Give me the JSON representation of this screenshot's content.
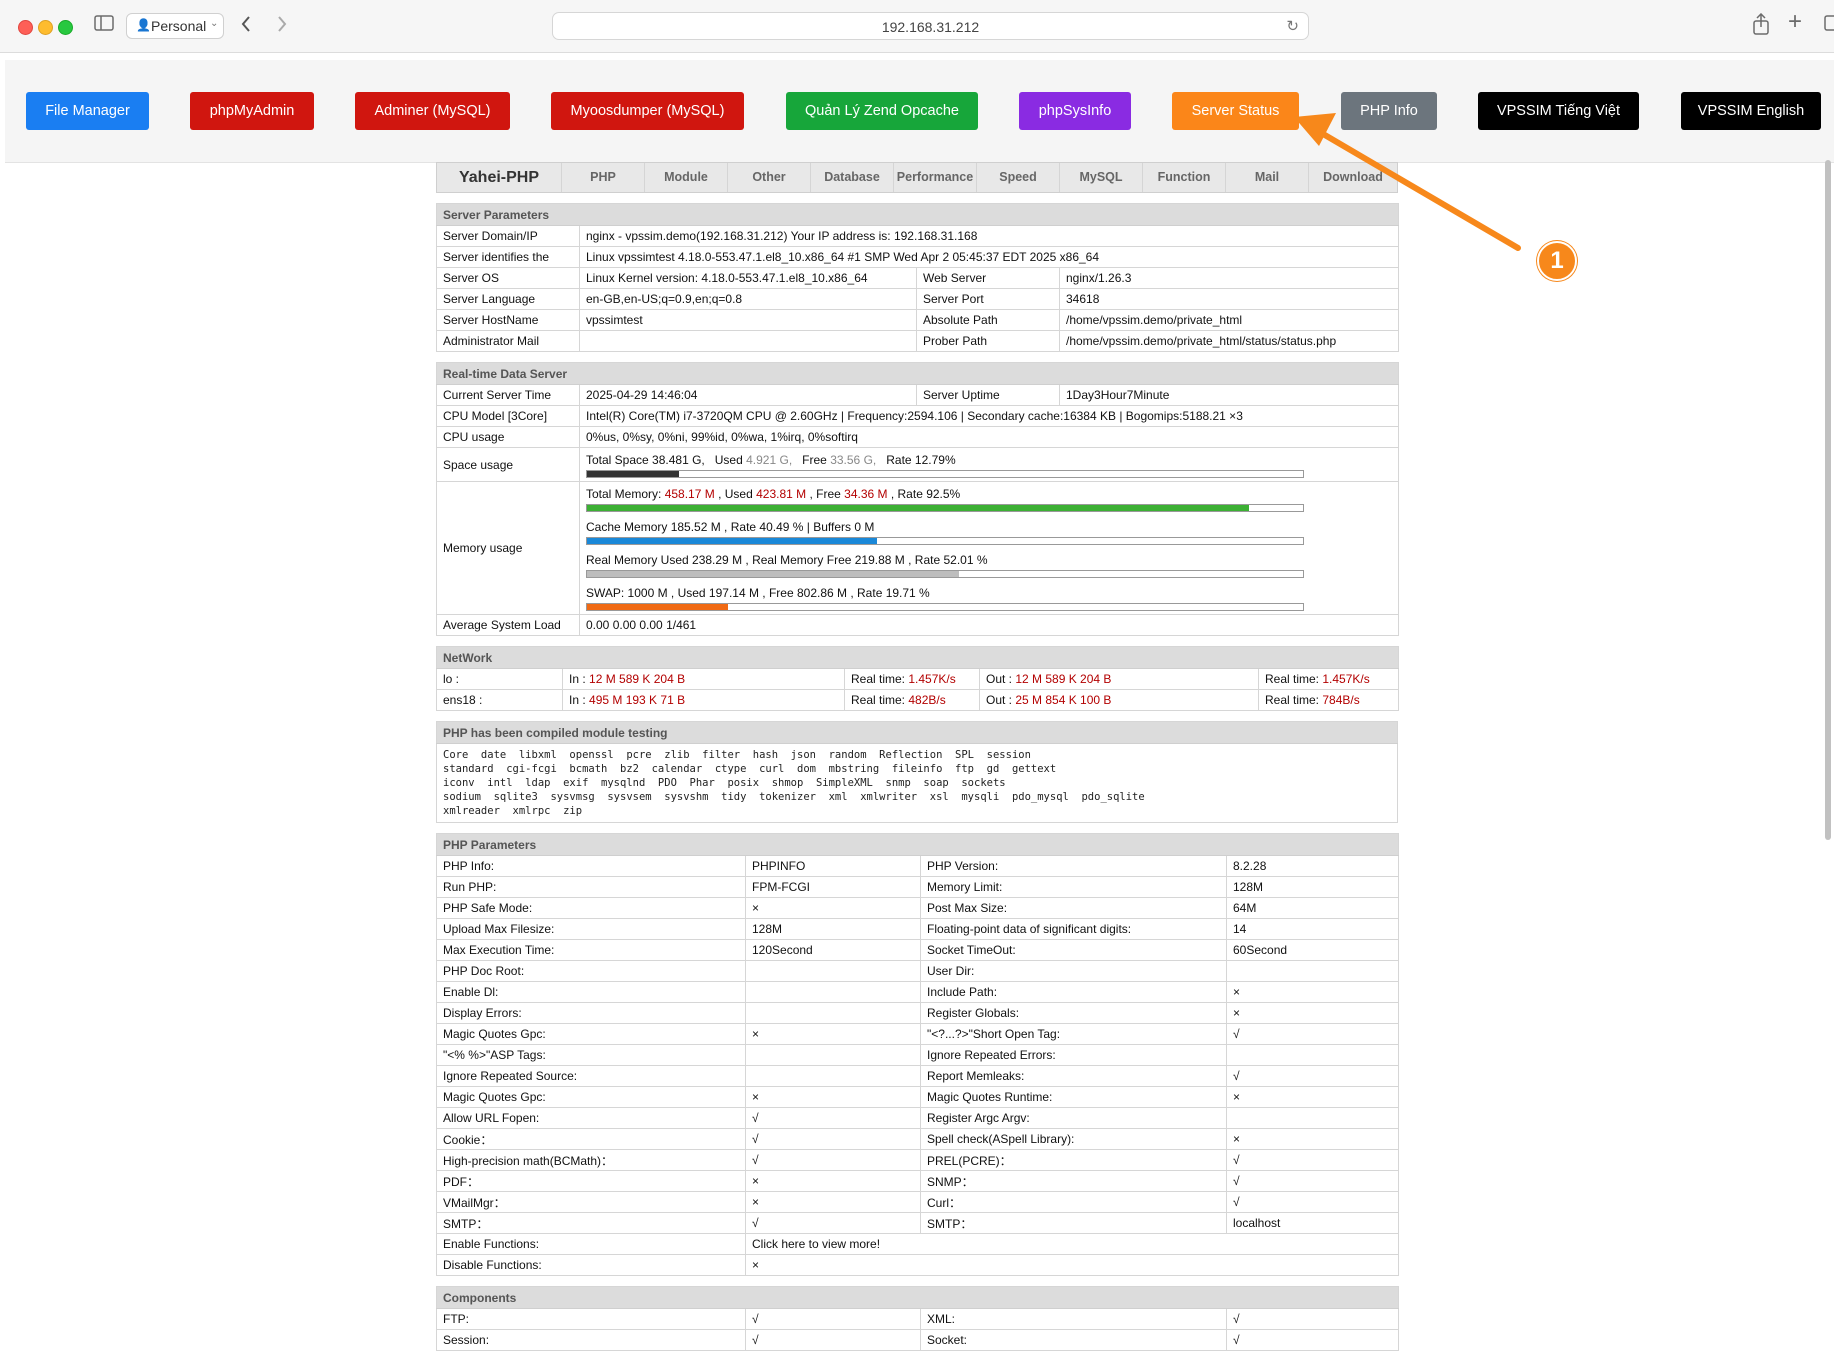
{
  "browser": {
    "profile": "Personal",
    "url": "192.168.31.212"
  },
  "nav": [
    {
      "label": "File Manager",
      "color": "#1a7ef2"
    },
    {
      "label": "phpMyAdmin",
      "color": "#d0160f"
    },
    {
      "label": "Adminer (MySQL)",
      "color": "#d0160f"
    },
    {
      "label": "Myoosdumper (MySQL)",
      "color": "#d0160f"
    },
    {
      "label": "Quản Lý Zend Opcache",
      "color": "#17a63a"
    },
    {
      "label": "phpSysInfo",
      "color": "#8a2be2"
    },
    {
      "label": "Server Status",
      "color": "#fb8619"
    },
    {
      "label": "PHP Info",
      "color": "#6c757d"
    },
    {
      "label": "VPSSIM Tiếng Việt",
      "color": "#000000"
    },
    {
      "label": "VPSSIM English",
      "color": "#000000"
    }
  ],
  "tabs": [
    "Yahei-PHP",
    "PHP",
    "Module",
    "Other",
    "Database",
    "Performance",
    "Speed",
    "MySQL",
    "Function",
    "Mail",
    "Download"
  ],
  "server_params": {
    "title": "Server Parameters",
    "domain_label": "Server Domain/IP",
    "domain_value": "nginx - vpssim.demo(192.168.31.212)  Your IP address is: 192.168.31.168",
    "ident_label": "Server identifies the",
    "ident_value": "Linux vpssimtest 4.18.0-553.47.1.el8_10.x86_64 #1 SMP Wed Apr 2 05:45:37 EDT 2025 x86_64",
    "os_label": "Server OS",
    "os_value": "Linux  Kernel version: 4.18.0-553.47.1.el8_10.x86_64",
    "web_label": "Web Server",
    "web_value": "nginx/1.26.3",
    "lang_label": "Server Language",
    "lang_value": "en-GB,en-US;q=0.9,en;q=0.8",
    "port_label": "Server Port",
    "port_value": "34618",
    "host_label": "Server HostName",
    "host_value": "vpssimtest",
    "abs_label": "Absolute Path",
    "abs_value": "/home/vpssim.demo/private_html",
    "mail_label": "Administrator Mail",
    "mail_value": "",
    "prober_label": "Prober Path",
    "prober_value": "/home/vpssim.demo/private_html/status/status.php"
  },
  "realtime": {
    "title": "Real-time Data Server",
    "time_label": "Current Server Time",
    "time_value": "2025-04-29 14:46:04",
    "uptime_label": "Server Uptime",
    "uptime_value": "1Day3Hour7Minute",
    "cpu_label": "CPU Model [3Core]",
    "cpu_value": "Intel(R) Core(TM) i7-3720QM CPU @ 2.60GHz | Frequency:2594.106 | Secondary cache:16384 KB | Bogomips:5188.21 ×3",
    "cpu_usage_label": "CPU usage",
    "cpu_usage_value": "0%us, 0%sy, 0%ni, 99%id, 0%wa, 1%irq, 0%softirq",
    "space_label": "Space usage",
    "space": {
      "total": "Total Space 38.481 G,",
      "used_lbl": "Used",
      "used": "4.921 G,",
      "free_lbl": "Free",
      "free": "33.56 G,",
      "rate": "Rate 12.79%",
      "fraction": 0.1279
    },
    "mem_label": "Memory usage",
    "mem_total": {
      "t1": "Total Memory: ",
      "v1": "458.17 M",
      "t2": " , Used ",
      "v2": "423.81 M",
      "t3": " , Free ",
      "v3": "34.36 M",
      "t4": " , Rate 92.5%",
      "fraction": 0.925
    },
    "mem_cache": {
      "text": "Cache Memory 185.52 M , Rate 40.49 % | Buffers 0 M",
      "fraction": 0.4049
    },
    "mem_real": {
      "text": "Real Memory Used 238.29 M , Real Memory Free 219.88 M , Rate 52.01 %",
      "fraction": 0.5201
    },
    "mem_swap": {
      "text": "SWAP: 1000 M , Used 197.14 M , Free 802.86 M , Rate 19.71 %",
      "fraction": 0.1971
    },
    "load_label": "Average System Load",
    "load_value": "0.00 0.00 0.00 1/461"
  },
  "network": {
    "title": "NetWork",
    "rows": [
      {
        "iface": "lo :",
        "in_lbl": "In : ",
        "in": "12 M 589 K 204 B",
        "rt_lbl": "Real time: ",
        "rt_in": "1.457K/s",
        "out_lbl": "Out : ",
        "out": "12 M 589 K 204 B",
        "rt_out": "1.457K/s"
      },
      {
        "iface": "ens18 :",
        "in_lbl": "In : ",
        "in": "495 M 193 K 71 B",
        "rt_lbl": "Real time: ",
        "rt_in": "482B/s",
        "out_lbl": "Out : ",
        "out": "25 M 854 K 100 B",
        "rt_out": "784B/s"
      }
    ]
  },
  "modules": {
    "title": "PHP has been compiled module testing",
    "text": "Core  date  libxml  openssl  pcre  zlib  filter  hash  json  random  Reflection  SPL  session\nstandard  cgi-fcgi  bcmath  bz2  calendar  ctype  curl  dom  mbstring  fileinfo  ftp  gd  gettext\niconv  intl  ldap  exif  mysqlnd  PDO  Phar  posix  shmop  SimpleXML  snmp  soap  sockets\nsodium  sqlite3  sysvmsg  sysvsem  sysvshm  tidy  tokenizer  xml  xmlwriter  xsl  mysqli  pdo_mysql  pdo_sqlite\nxmlreader  xmlrpc  zip"
  },
  "php_params": {
    "title": "PHP Parameters",
    "rows": [
      [
        "PHP Info:",
        "PHPINFO",
        "PHP Version:",
        "8.2.28"
      ],
      [
        "Run PHP:",
        "FPM-FCGI",
        "Memory Limit:",
        "128M"
      ],
      [
        "PHP Safe Mode:",
        "×",
        "Post Max Size:",
        "64M"
      ],
      [
        "Upload Max Filesize:",
        "128M",
        "Floating-point data of significant digits:",
        "14"
      ],
      [
        "Max Execution Time:",
        "120Second",
        "Socket TimeOut:",
        "60Second"
      ],
      [
        "PHP Doc Root:",
        "",
        "User Dir:",
        ""
      ],
      [
        "Enable Dl:",
        "",
        "Include Path:",
        "×"
      ],
      [
        "Display Errors:",
        "",
        "Register Globals:",
        "×"
      ],
      [
        "Magic Quotes Gpc:",
        "×",
        "\"<?...?>\"Short Open Tag:",
        "√"
      ],
      [
        "\"<% %>\"ASP Tags:",
        "",
        "Ignore Repeated Errors:",
        ""
      ],
      [
        "Ignore Repeated Source:",
        "",
        "Report Memleaks:",
        "√"
      ],
      [
        "Magic Quotes Gpc:",
        "×",
        "Magic Quotes Runtime:",
        "×"
      ],
      [
        "Allow URL Fopen:",
        "√",
        "Register Argc Argv:",
        ""
      ],
      [
        "Cookie：",
        "√",
        "Spell check(ASpell Library):",
        "×"
      ],
      [
        "High-precision math(BCMath)：",
        "√",
        "PREL(PCRE)：",
        "√"
      ],
      [
        "PDF：",
        "×",
        "SNMP：",
        "√"
      ],
      [
        "VMailMgr：",
        "×",
        "Curl：",
        "√"
      ],
      [
        "SMTP：",
        "√",
        "SMTP：",
        "localhost"
      ]
    ],
    "enable_label": "Enable Functions:",
    "enable_value": "Click here to view more!",
    "disable_label": "Disable Functions:",
    "disable_value": "×"
  },
  "components": {
    "title": "Components",
    "rows": [
      [
        "FTP:",
        "√",
        "XML:",
        "√"
      ],
      [
        "Session:",
        "√",
        "Socket:",
        "√"
      ]
    ]
  },
  "annotation": {
    "number": "1",
    "color": "#f7881b"
  }
}
